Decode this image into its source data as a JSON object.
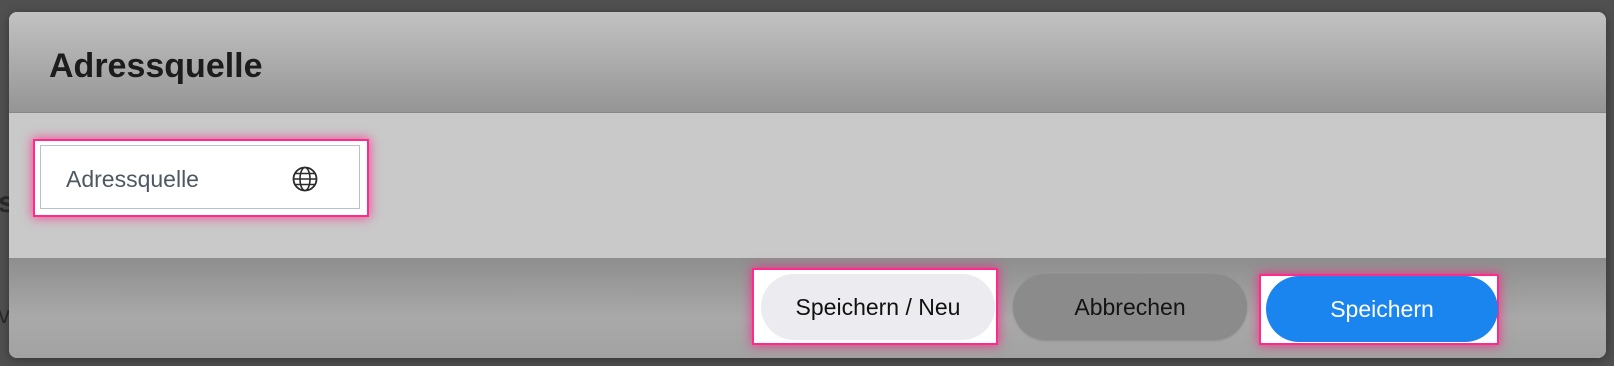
{
  "background": {
    "partial_heading": "s",
    "partial_text": "v"
  },
  "dialog": {
    "title": "Adressquelle",
    "field": {
      "value": "Adressquelle",
      "icon": "globe-icon"
    },
    "buttons": {
      "save_new": "Speichern / Neu",
      "cancel": "Abbrechen",
      "save": "Speichern"
    }
  },
  "colors": {
    "primary": "#1a84ef",
    "highlight": "#ff2a8a",
    "secondary_button": "#8b8b8b",
    "light_button": "#ececf0"
  }
}
